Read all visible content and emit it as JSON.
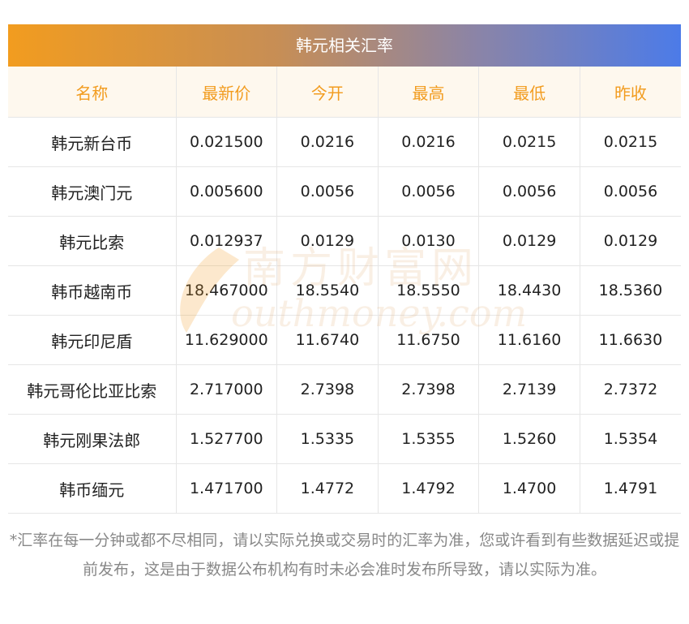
{
  "title": "韩元相关汇率",
  "columns": [
    "名称",
    "最新价",
    "今开",
    "最高",
    "最低",
    "昨收"
  ],
  "rows": [
    {
      "name": "韩元新台币",
      "latest": "0.021500",
      "open": "0.0216",
      "high": "0.0216",
      "low": "0.0215",
      "prev_close": "0.0215"
    },
    {
      "name": "韩元澳门元",
      "latest": "0.005600",
      "open": "0.0056",
      "high": "0.0056",
      "low": "0.0056",
      "prev_close": "0.0056"
    },
    {
      "name": "韩元比索",
      "latest": "0.012937",
      "open": "0.0129",
      "high": "0.0130",
      "low": "0.0129",
      "prev_close": "0.0129"
    },
    {
      "name": "韩币越南币",
      "latest": "18.467000",
      "open": "18.5540",
      "high": "18.5550",
      "low": "18.4430",
      "prev_close": "18.5360"
    },
    {
      "name": "韩元印尼盾",
      "latest": "11.629000",
      "open": "11.6740",
      "high": "11.6750",
      "low": "11.6160",
      "prev_close": "11.6630"
    },
    {
      "name": "韩元哥伦比亚比索",
      "latest": "2.717000",
      "open": "2.7398",
      "high": "2.7398",
      "low": "2.7139",
      "prev_close": "2.7372"
    },
    {
      "name": "韩元刚果法郎",
      "latest": "1.527700",
      "open": "1.5335",
      "high": "1.5355",
      "low": "1.5260",
      "prev_close": "1.5354"
    },
    {
      "name": "韩币缅元",
      "latest": "1.471700",
      "open": "1.4772",
      "high": "1.4792",
      "low": "1.4700",
      "prev_close": "1.4791"
    }
  ],
  "watermark": {
    "cn": "南方财富网",
    "en": "outhmoney.com"
  },
  "footnote": "*汇率在每一分钟或都不尽相同，请以实际兑换或交易时的汇率为准，您或许看到有些数据延迟或提前发布，这是由于数据公布机构有时未必会准时发布所导致，请以实际为准。",
  "colors": {
    "header_text": "#f29c1f",
    "header_bg": "#fef8ee",
    "gradient_start": "#f29c1f",
    "gradient_end": "#4c7be8",
    "footnote": "#888888"
  }
}
